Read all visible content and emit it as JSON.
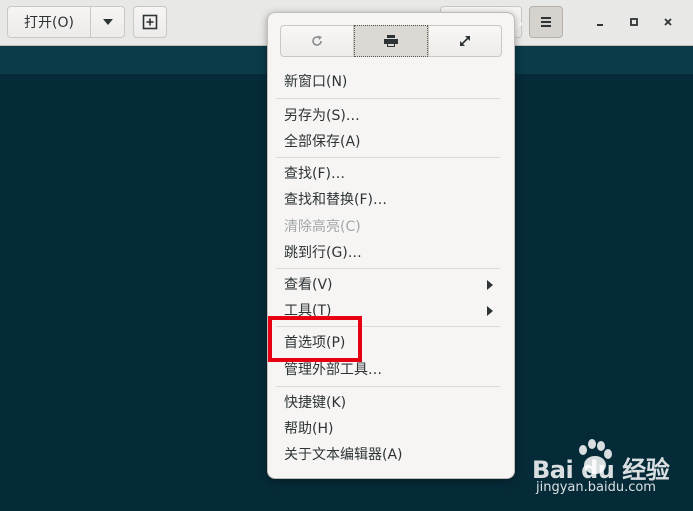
{
  "toolbar": {
    "open_label": "打开(O)",
    "open_dropdown_icon": "triangle-down",
    "new_document_icon": "new-tab-plus",
    "menu_icon": "hamburger",
    "window_controls": [
      "minimize",
      "maximize",
      "close"
    ]
  },
  "popover": {
    "buttons": [
      {
        "name": "reload",
        "icon": "reload-icon"
      },
      {
        "name": "print",
        "icon": "print-icon"
      },
      {
        "name": "fullscreen",
        "icon": "fullscreen-icon"
      }
    ],
    "items": [
      {
        "label": "新窗口(N)"
      },
      {
        "label": "另存为(S)…"
      },
      {
        "label": "全部保存(A)"
      },
      {
        "label": "查找(F)…"
      },
      {
        "label": "查找和替换(F)…"
      },
      {
        "label": "清除高亮(C)",
        "disabled": true
      },
      {
        "label": "跳到行(G)…"
      },
      {
        "label": "查看(V)",
        "submenu": true
      },
      {
        "label": "工具(T)",
        "submenu": true
      },
      {
        "label": "首选项(P)",
        "highlighted": true
      },
      {
        "label": "管理外部工具…"
      },
      {
        "label": "快捷键(K)"
      },
      {
        "label": "帮助(H)"
      },
      {
        "label": "关于文本编辑器(A)"
      }
    ]
  },
  "colors": {
    "editor_bg": "#062b38",
    "highlight_box": "#e60012"
  },
  "watermark": {
    "logo_text": "Bai du 经验",
    "url": "jingyan.baidu.com"
  }
}
